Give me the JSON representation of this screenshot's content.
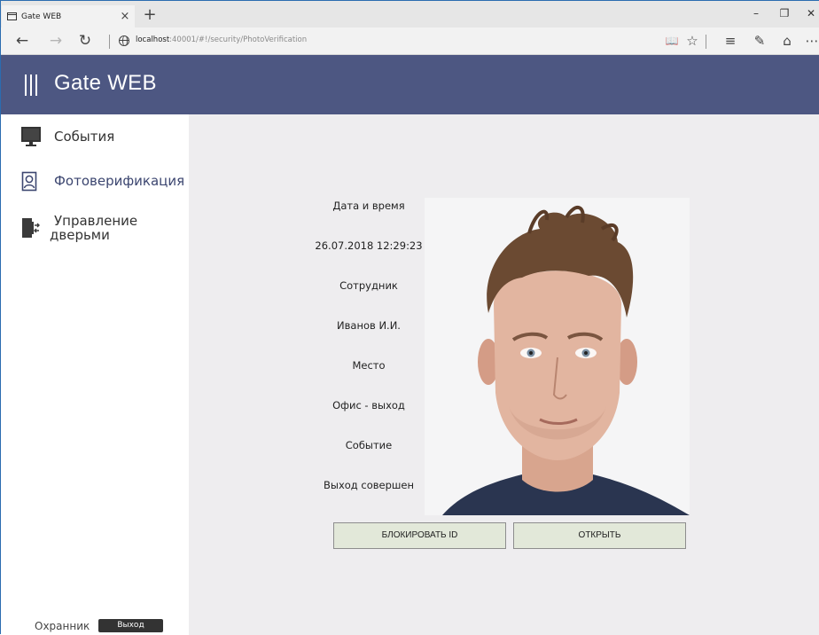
{
  "browser": {
    "tab_title": "Gate WEB",
    "tab_close": "×",
    "new_tab": "+",
    "url_host": "localhost",
    "url_path": ":40001/#!/security/PhotoVerification",
    "window_controls": {
      "minimize": "–",
      "restore": "❐",
      "close": "✕"
    },
    "nav": {
      "back": "←",
      "forward": "→",
      "refresh": "↻"
    },
    "toolbar": {
      "reading_view": "📖",
      "favorite": "☆",
      "hub": "≡",
      "notes": "✎",
      "share": "⌂",
      "more": "⋯"
    }
  },
  "app": {
    "title": "Gate WEB",
    "accent_color": "#4d5782"
  },
  "sidebar": {
    "items": [
      {
        "label": "События",
        "icon": "monitor-icon"
      },
      {
        "label": "Фотоверификация",
        "icon": "id-portrait-icon"
      },
      {
        "label_line1": "Управление",
        "label_line2": "дверьми",
        "icon": "door-icon"
      }
    ],
    "user_role": "Охранник",
    "logout_label": "Выход"
  },
  "verification": {
    "datetime_label": "Дата и время",
    "datetime_value": "26.07.2018 12:29:23",
    "employee_label": "Сотрудник",
    "employee_value": "Иванов И.И.",
    "place_label": "Место",
    "place_value": "Офис - выход",
    "event_label": "Событие",
    "event_value": "Выход совершен",
    "photo": "employee-photo"
  },
  "actions": {
    "block_label": "БЛОКИРОВАТЬ ID",
    "open_label": "ОТКРЫТЬ"
  }
}
